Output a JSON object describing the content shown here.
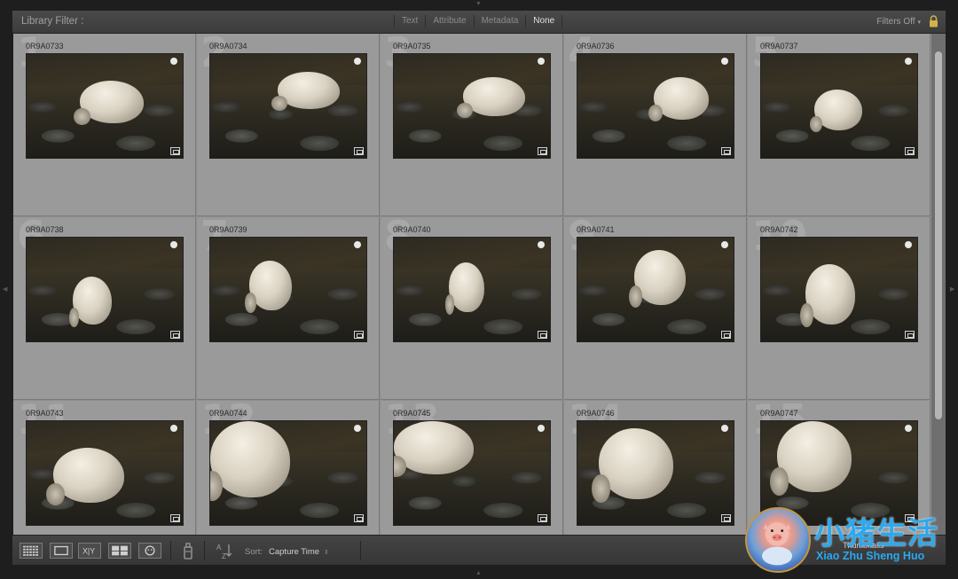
{
  "filter_bar": {
    "title": "Library Filter :",
    "tabs": [
      "Text",
      "Attribute",
      "Metadata",
      "None"
    ],
    "active_tab": "None",
    "filters_label": "Filters Off"
  },
  "grid": {
    "cells": [
      {
        "index": "1",
        "name": "0R9A0733"
      },
      {
        "index": "2",
        "name": "0R9A0734"
      },
      {
        "index": "3",
        "name": "0R9A0735"
      },
      {
        "index": "4",
        "name": "0R9A0736"
      },
      {
        "index": "5",
        "name": "0R9A0737"
      },
      {
        "index": "6",
        "name": "0R9A0738"
      },
      {
        "index": "7",
        "name": "0R9A0739"
      },
      {
        "index": "8",
        "name": "0R9A0740"
      },
      {
        "index": "9",
        "name": "0R9A0741"
      },
      {
        "index": "10",
        "name": "0R9A0742"
      },
      {
        "index": "11",
        "name": "0R9A0743"
      },
      {
        "index": "12",
        "name": "0R9A0744"
      },
      {
        "index": "13",
        "name": "0R9A0745"
      },
      {
        "index": "14",
        "name": "0R9A0746"
      },
      {
        "index": "15",
        "name": "0R9A0747"
      }
    ]
  },
  "toolbar": {
    "sort_label": "Sort:",
    "sort_value": "Capture Time",
    "thumbnails_label": "Thumbnails"
  },
  "watermark": {
    "title": "小猪生活",
    "subtitle": "Xiao Zhu Sheng Huo"
  }
}
